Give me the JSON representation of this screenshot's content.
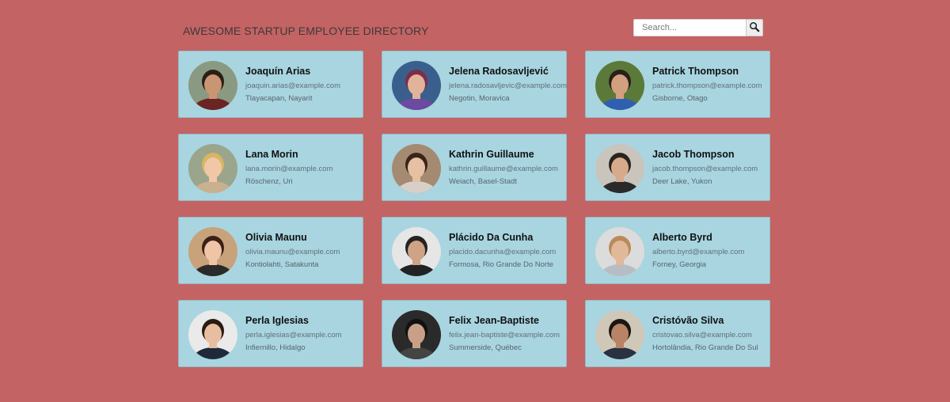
{
  "header": {
    "title": "AWESOME STARTUP EMPLOYEE DIRECTORY",
    "search_placeholder": "Search...",
    "search_icon": "magnifier-icon"
  },
  "employees": [
    {
      "name": "Joaquín Arias",
      "email": "joaquin.arias@example.com",
      "location": "Tlayacapan, Nayarit",
      "avatar": {
        "bg": "#8a9a82",
        "skin": "#c99572",
        "hair": "#2a1e17",
        "shirt": "#6b2424"
      }
    },
    {
      "name": "Jelena Radosavljević",
      "email": "jelena.radosavljevic@example.com",
      "location": "Negotin, Moravica",
      "avatar": {
        "bg": "#3b5f8c",
        "skin": "#e0b39a",
        "hair": "#7a2e4a",
        "shirt": "#6b4aa0"
      }
    },
    {
      "name": "Patrick Thompson",
      "email": "patrick.thompson@example.com",
      "location": "Gisborne, Otago",
      "avatar": {
        "bg": "#5b7a3a",
        "skin": "#d2a07e",
        "hair": "#2a2018",
        "shirt": "#2f5fb0"
      }
    },
    {
      "name": "Lana Morin",
      "email": "lana.morin@example.com",
      "location": "Röschenz, Uri",
      "avatar": {
        "bg": "#9aa58c",
        "skin": "#f0c8a8",
        "hair": "#d7b565",
        "shirt": "#c9b08f"
      }
    },
    {
      "name": "Kathrin Guillaume",
      "email": "kathrin.guillaume@example.com",
      "location": "Weiach, Basel-Stadt",
      "avatar": {
        "bg": "#a48a70",
        "skin": "#e5c0a2",
        "hair": "#3a2419",
        "shirt": "#d8d0c8"
      }
    },
    {
      "name": "Jacob Thompson",
      "email": "jacob.thompson@example.com",
      "location": "Deer Lake, Yukon",
      "avatar": {
        "bg": "#c9c5bd",
        "skin": "#d6ab8c",
        "hair": "#2a2420",
        "shirt": "#2a2a2a"
      }
    },
    {
      "name": "Olivia Maunu",
      "email": "olivia.maunu@example.com",
      "location": "Kontiolahti, Satakunta",
      "avatar": {
        "bg": "#c8a27a",
        "skin": "#f0c4a6",
        "hair": "#3a2016",
        "shirt": "#2a2a2a"
      }
    },
    {
      "name": "Plácido Da Cunha",
      "email": "placido.dacunha@example.com",
      "location": "Formosa, Rio Grande Do Norte",
      "avatar": {
        "bg": "#e6e6e6",
        "skin": "#cfa386",
        "hair": "#262220",
        "shirt": "#222222"
      }
    },
    {
      "name": "Alberto Byrd",
      "email": "alberto.byrd@example.com",
      "location": "Forney, Georgia",
      "avatar": {
        "bg": "#dcdcdc",
        "skin": "#e1b89a",
        "hair": "#b98a5a",
        "shirt": "#b7bdc4"
      }
    },
    {
      "name": "Perla Iglesias",
      "email": "perla.iglesias@example.com",
      "location": "Infiernillo, Hidalgo",
      "avatar": {
        "bg": "#eaeaea",
        "skin": "#e8bea0",
        "hair": "#2a1a14",
        "shirt": "#1e2a3a"
      }
    },
    {
      "name": "Felix Jean-Baptiste",
      "email": "felix.jean-baptiste@example.com",
      "location": "Summerside, Québec",
      "avatar": {
        "bg": "#2a2a2a",
        "skin": "#c8a088",
        "hair": "#111111",
        "shirt": "#444444"
      }
    },
    {
      "name": "Cristóvão Silva",
      "email": "cristovao.silva@example.com",
      "location": "Hortolândia, Rio Grande Do Sul",
      "avatar": {
        "bg": "#cfc7b8",
        "skin": "#b98466",
        "hair": "#1c1612",
        "shirt": "#2a3140"
      }
    }
  ]
}
